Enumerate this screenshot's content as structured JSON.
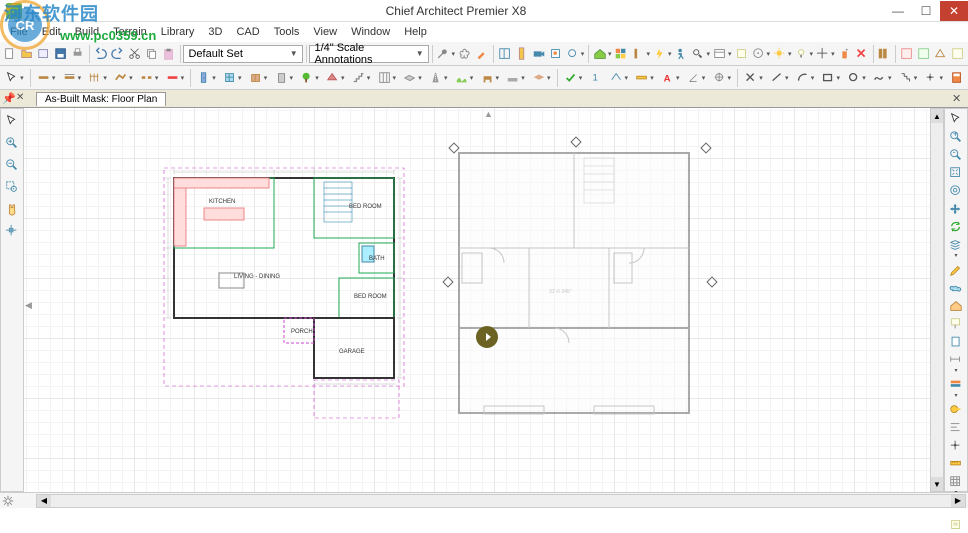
{
  "app": {
    "title": "Chief Architect Premier X8"
  },
  "watermark": {
    "text": "河东软件园",
    "url": "www.pc0359.cn"
  },
  "window_controls": {
    "minimize": "—",
    "maximize": "☐",
    "close": "✕"
  },
  "menu": [
    "File",
    "Edit",
    "Build",
    "Terrain",
    "Library",
    "3D",
    "CAD",
    "Tools",
    "View",
    "Window",
    "Help"
  ],
  "toolbar1": {
    "dropdown1": "Default Set",
    "dropdown2": "1/4\" Scale Annotations"
  },
  "document_tab": "As-Built Mask: Floor Plan",
  "rooms": {
    "kitchen": "KITCHEN",
    "bedroom": "BED ROOM",
    "living": "LIVING - DINING",
    "bath": "BATH",
    "bedroom2": "BED ROOM",
    "porch": "PORCH",
    "garage": "GARAGE"
  },
  "dims": {
    "right_plan": "31'-6 245\""
  },
  "icons": {
    "left_side": [
      "select-arrow",
      "zoom-in",
      "zoom-out",
      "zoom-window",
      "hand-pan",
      "crosshair",
      "divider",
      "divider"
    ],
    "right_side": [
      "select",
      "zoom-in",
      "zoom-out",
      "fit-window",
      "crosshair-target",
      "pan",
      "refresh",
      "layers",
      "markup",
      "paint",
      "fill",
      "tag",
      "text",
      "dimension",
      "layer-set",
      "tape",
      "align",
      "point",
      "ruler",
      "grid",
      "wall",
      "note",
      "calc"
    ]
  }
}
